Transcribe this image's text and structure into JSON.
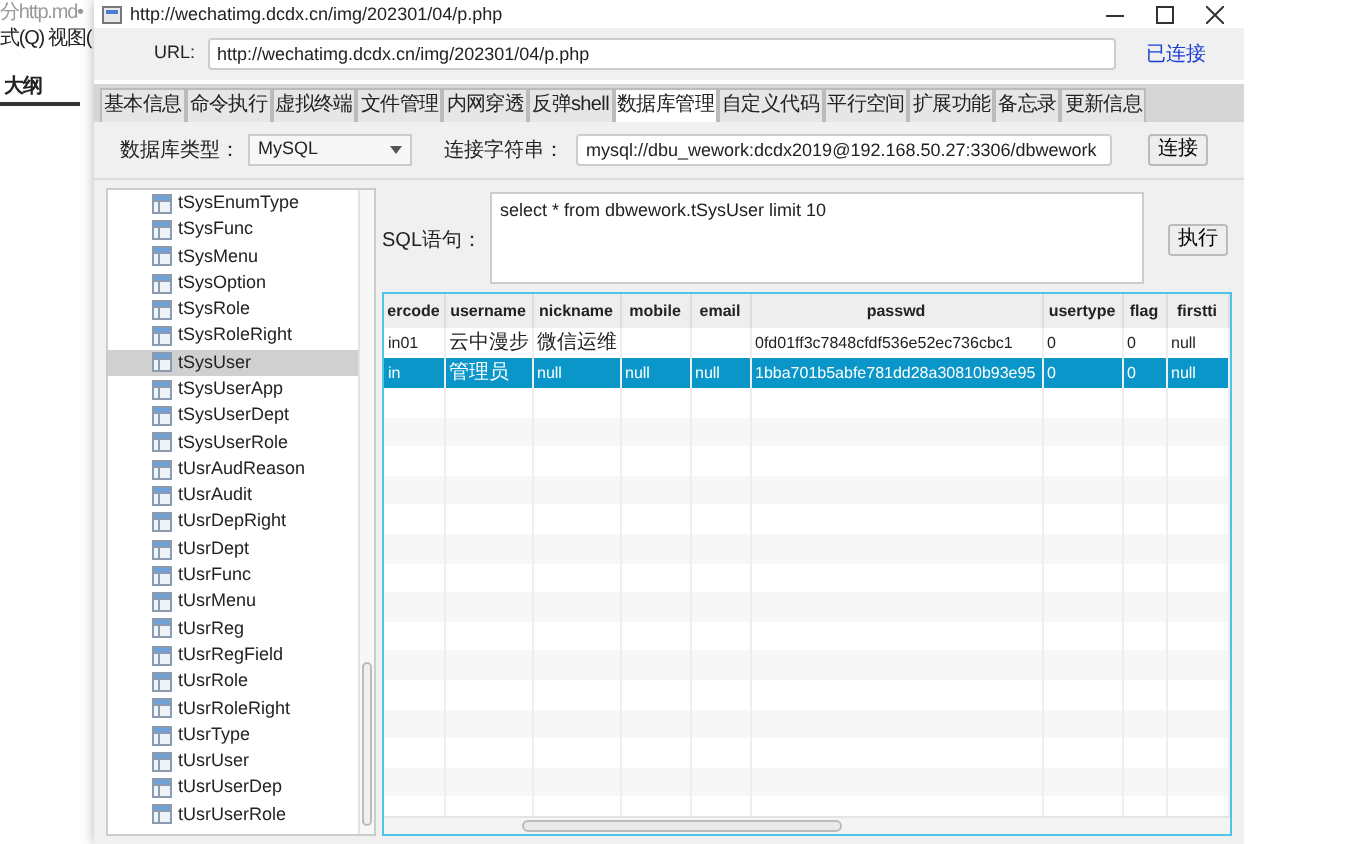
{
  "background_app": {
    "tab_title": "分http.md•",
    "menu": [
      "式(Q)",
      "视图("
    ],
    "panel_title": "大纲"
  },
  "window": {
    "title": "http://wechatimg.dcdx.cn/img/202301/04/p.php",
    "url_label": "URL:",
    "url": "http://wechatimg.dcdx.cn/img/202301/04/p.php",
    "status": "已连接"
  },
  "tabs": [
    {
      "label": "基本信息",
      "selected": false
    },
    {
      "label": "命令执行",
      "selected": false
    },
    {
      "label": "虚拟终端",
      "selected": false
    },
    {
      "label": "文件管理",
      "selected": false
    },
    {
      "label": "内网穿透",
      "selected": false
    },
    {
      "label": "反弹shell",
      "selected": false
    },
    {
      "label": "数据库管理",
      "selected": true
    },
    {
      "label": "自定义代码",
      "selected": false
    },
    {
      "label": "平行空间",
      "selected": false
    },
    {
      "label": "扩展功能",
      "selected": false
    },
    {
      "label": "备忘录",
      "selected": false
    },
    {
      "label": "更新信息",
      "selected": false
    }
  ],
  "db": {
    "type_label": "数据库类型：",
    "type": "MySQL",
    "conn_label": "连接字符串：",
    "conn": "mysql://dbu_wework:dcdx2019@192.168.50.27:3306/dbwework",
    "connect_button": "连接"
  },
  "tree": {
    "items": [
      {
        "label": "tSysEnumType",
        "selected": false
      },
      {
        "label": "tSysFunc",
        "selected": false
      },
      {
        "label": "tSysMenu",
        "selected": false
      },
      {
        "label": "tSysOption",
        "selected": false
      },
      {
        "label": "tSysRole",
        "selected": false
      },
      {
        "label": "tSysRoleRight",
        "selected": false
      },
      {
        "label": "tSysUser",
        "selected": true
      },
      {
        "label": "tSysUserApp",
        "selected": false
      },
      {
        "label": "tSysUserDept",
        "selected": false
      },
      {
        "label": "tSysUserRole",
        "selected": false
      },
      {
        "label": "tUsrAudReason",
        "selected": false
      },
      {
        "label": "tUsrAudit",
        "selected": false
      },
      {
        "label": "tUsrDepRight",
        "selected": false
      },
      {
        "label": "tUsrDept",
        "selected": false
      },
      {
        "label": "tUsrFunc",
        "selected": false
      },
      {
        "label": "tUsrMenu",
        "selected": false
      },
      {
        "label": "tUsrReg",
        "selected": false
      },
      {
        "label": "tUsrRegField",
        "selected": false
      },
      {
        "label": "tUsrRole",
        "selected": false
      },
      {
        "label": "tUsrRoleRight",
        "selected": false
      },
      {
        "label": "tUsrType",
        "selected": false
      },
      {
        "label": "tUsrUser",
        "selected": false
      },
      {
        "label": "tUsrUserDep",
        "selected": false
      },
      {
        "label": "tUsrUserRole",
        "selected": false
      }
    ]
  },
  "sql": {
    "label": "SQL语句：",
    "query": "select * from dbwework.tSysUser limit 10",
    "run_button": "执行"
  },
  "table": {
    "columns": [
      "ercode",
      "username",
      "nickname",
      "mobile",
      "email",
      "passwd",
      "usertype",
      "flag",
      "firstti"
    ],
    "rows": [
      {
        "cells": [
          "in01",
          "云中漫步",
          "微信运维",
          "",
          "",
          "0fd01ff3c7848cfdf536e52ec736cbc1",
          "0",
          "0",
          "null"
        ],
        "selected": false
      },
      {
        "cells": [
          "in",
          "管理员",
          "null",
          "null",
          "null",
          "1bba701b5abfe781dd28a30810b93e95",
          "0",
          "0",
          "null"
        ],
        "selected": true
      }
    ]
  }
}
